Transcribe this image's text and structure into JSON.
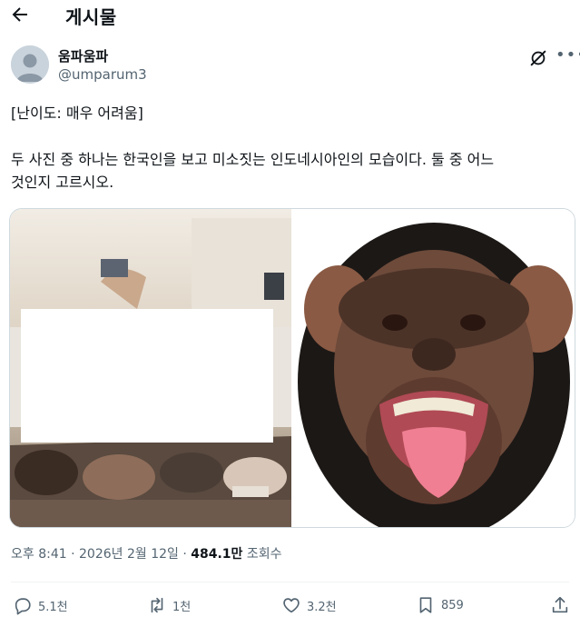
{
  "header": {
    "title": "게시물",
    "back_icon": "arrow-left-icon"
  },
  "author": {
    "name": "움파움파",
    "handle": "@umparum3"
  },
  "post": {
    "line1": "[난이도: 매우 어려움]",
    "line2": "두 사진 중 하나는 한국인을 보고 미소짓는 인도네시아인의 모습이다. 둘 중 어느",
    "line3": "것인지 고르시오."
  },
  "meta": {
    "time": "오후 8:41 · 2026년 2월 12일 · ",
    "views_count": "484.1만",
    "views_label": " 조회수"
  },
  "actions": {
    "reply": "5.1천",
    "repost": "1천",
    "like": "3.2천",
    "bookmark": "859"
  },
  "colors": {
    "text": "#0f1419",
    "secondary": "#536471",
    "border": "#cfd9de"
  }
}
